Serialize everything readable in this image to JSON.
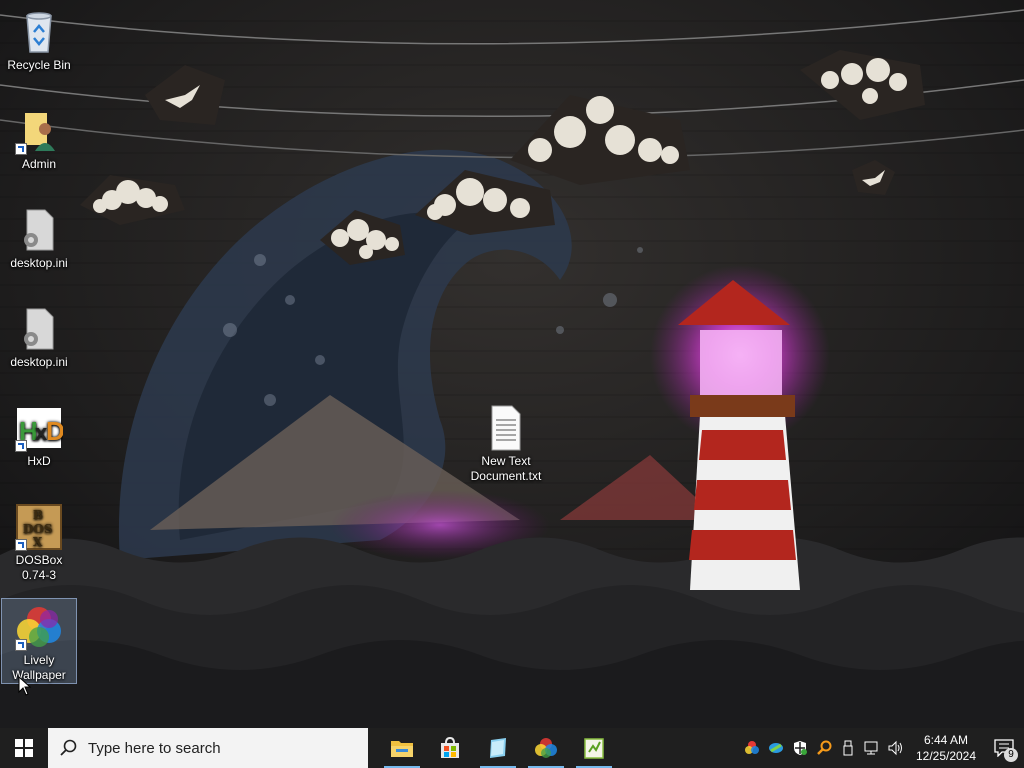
{
  "desktop": {
    "icons": [
      {
        "label": "Recycle Bin",
        "icon": "recycle-bin-icon"
      },
      {
        "label": "Admin",
        "icon": "user-folder-icon"
      },
      {
        "label": "desktop.ini",
        "icon": "settings-file-icon"
      },
      {
        "label": "desktop.ini",
        "icon": "settings-file-icon"
      },
      {
        "label": "HxD",
        "icon": "hxd-icon"
      },
      {
        "label": "DOSBox\n0.74-3",
        "icon": "dosbox-icon"
      },
      {
        "label": "Lively\nWallpaper",
        "icon": "lively-wallpaper-icon",
        "selected": true
      },
      {
        "label": "New Text\nDocument.txt",
        "icon": "text-file-icon"
      }
    ]
  },
  "taskbar": {
    "search_placeholder": "Type here to search",
    "apps": [
      {
        "name": "File Explorer",
        "icon": "file-explorer-icon",
        "active": true
      },
      {
        "name": "Microsoft Store",
        "icon": "store-icon",
        "active": false
      },
      {
        "name": "Notepad",
        "icon": "notepad-icon",
        "active": true
      },
      {
        "name": "Lively Wallpaper",
        "icon": "lively-wallpaper-icon",
        "active": true
      },
      {
        "name": "Notepad++",
        "icon": "notepad-plus-icon",
        "active": true
      }
    ],
    "tray": {
      "icons": [
        "lively-tray-icon",
        "network-tray-icon",
        "defender-icon",
        "search-tray-icon",
        "usb-icon",
        "network-icon",
        "volume-icon"
      ],
      "time": "6:44 AM",
      "date": "12/25/2024",
      "notification_count": "9"
    }
  },
  "colors": {
    "taskbar_bg": "#1f1f1f",
    "accent": "#76b9ed",
    "lighthouse_glow": "#e040e0"
  }
}
